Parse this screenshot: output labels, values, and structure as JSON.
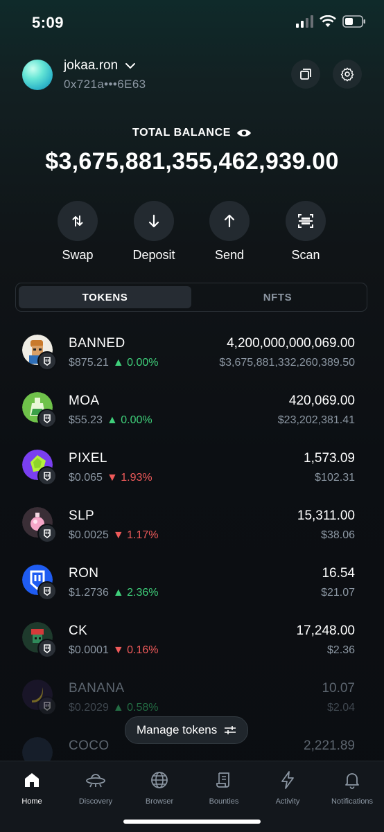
{
  "status": {
    "time": "5:09"
  },
  "account": {
    "name": "jokaa.ron",
    "address": "0x721a•••6E63"
  },
  "balance": {
    "label": "TOTAL BALANCE",
    "value": "$3,675,881,355,462,939.00"
  },
  "actions": [
    {
      "label": "Swap",
      "icon": "swap-icon"
    },
    {
      "label": "Deposit",
      "icon": "arrow-down-icon"
    },
    {
      "label": "Send",
      "icon": "arrow-up-icon"
    },
    {
      "label": "Scan",
      "icon": "scan-icon"
    }
  ],
  "tabs": [
    {
      "label": "TOKENS",
      "active": true
    },
    {
      "label": "NFTS",
      "active": false
    }
  ],
  "tokens": [
    {
      "symbol": "BANNED",
      "price": "$875.21",
      "change": "0.00%",
      "direction": "up",
      "amount": "4,200,000,000,069.00",
      "value": "$3,675,881,332,260,389.50",
      "color": "#c98a4a"
    },
    {
      "symbol": "MOA",
      "price": "$55.23",
      "change": "0.00%",
      "direction": "up",
      "amount": "420,069.00",
      "value": "$23,202,381.41",
      "color": "#6fc24a"
    },
    {
      "symbol": "PIXEL",
      "price": "$0.065",
      "change": "1.93%",
      "direction": "down",
      "amount": "1,573.09",
      "value": "$102.31",
      "color": "#7a3ff0"
    },
    {
      "symbol": "SLP",
      "price": "$0.0025",
      "change": "1.17%",
      "direction": "down",
      "amount": "15,311.00",
      "value": "$38.06",
      "color": "#3a2e36"
    },
    {
      "symbol": "RON",
      "price": "$1.2736",
      "change": "2.36%",
      "direction": "up",
      "amount": "16.54",
      "value": "$21.07",
      "color": "#1f5cf2"
    },
    {
      "symbol": "CK",
      "price": "$0.0001",
      "change": "0.16%",
      "direction": "down",
      "amount": "17,248.00",
      "value": "$2.36",
      "color": "#1e3a2c"
    },
    {
      "symbol": "BANANA",
      "price": "$0.2029",
      "change": "0.58%",
      "direction": "up",
      "amount": "10.07",
      "value": "$2.04",
      "color": "#2a1f44"
    },
    {
      "symbol": "COCO",
      "price": "",
      "change": "",
      "direction": "",
      "amount": "2,221.89",
      "value": "",
      "color": "#24344a"
    }
  ],
  "manage": {
    "label": "Manage tokens"
  },
  "nav": [
    {
      "label": "Home",
      "icon": "home-icon"
    },
    {
      "label": "Discovery",
      "icon": "ufo-icon"
    },
    {
      "label": "Browser",
      "icon": "globe-icon"
    },
    {
      "label": "Bounties",
      "icon": "scroll-icon"
    },
    {
      "label": "Activity",
      "icon": "lightning-icon"
    },
    {
      "label": "Notifications",
      "icon": "bell-icon"
    }
  ]
}
